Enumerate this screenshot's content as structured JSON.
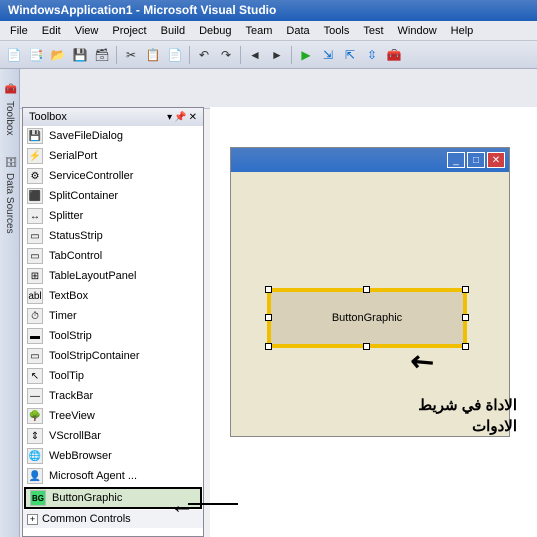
{
  "title": "WindowsApplication1 - Microsoft Visual Studio",
  "menu": [
    "File",
    "Edit",
    "View",
    "Project",
    "Build",
    "Debug",
    "Team",
    "Data",
    "Tools",
    "Test",
    "Window",
    "Help"
  ],
  "sidebar_tabs": [
    {
      "label": "Toolbox",
      "icon": "🧰"
    },
    {
      "label": "Data Sources",
      "icon": "🗄"
    }
  ],
  "toolbox": {
    "title": "Toolbox",
    "items": [
      {
        "label": "SaveFileDialog",
        "icon": "💾"
      },
      {
        "label": "SerialPort",
        "icon": "⚡"
      },
      {
        "label": "ServiceController",
        "icon": "⚙"
      },
      {
        "label": "SplitContainer",
        "icon": "⬛"
      },
      {
        "label": "Splitter",
        "icon": "↔"
      },
      {
        "label": "StatusStrip",
        "icon": "▭"
      },
      {
        "label": "TabControl",
        "icon": "▭"
      },
      {
        "label": "TableLayoutPanel",
        "icon": "⊞"
      },
      {
        "label": "TextBox",
        "icon": "abl"
      },
      {
        "label": "Timer",
        "icon": "⏱"
      },
      {
        "label": "ToolStrip",
        "icon": "▬"
      },
      {
        "label": "ToolStripContainer",
        "icon": "▭"
      },
      {
        "label": "ToolTip",
        "icon": "↖"
      },
      {
        "label": "TrackBar",
        "icon": "—"
      },
      {
        "label": "TreeView",
        "icon": "🌳"
      },
      {
        "label": "VScrollBar",
        "icon": "⇕"
      },
      {
        "label": "WebBrowser",
        "icon": "🌐"
      },
      {
        "label": "Microsoft Agent ...",
        "icon": "👤"
      },
      {
        "label": "ButtonGraphic",
        "icon": "BG",
        "selected": true
      }
    ],
    "group": "Common Controls"
  },
  "designer": {
    "control_label": "ButtonGraphic"
  },
  "annotation": {
    "line1": "الاداة في شريط",
    "line2": "الادوات"
  }
}
